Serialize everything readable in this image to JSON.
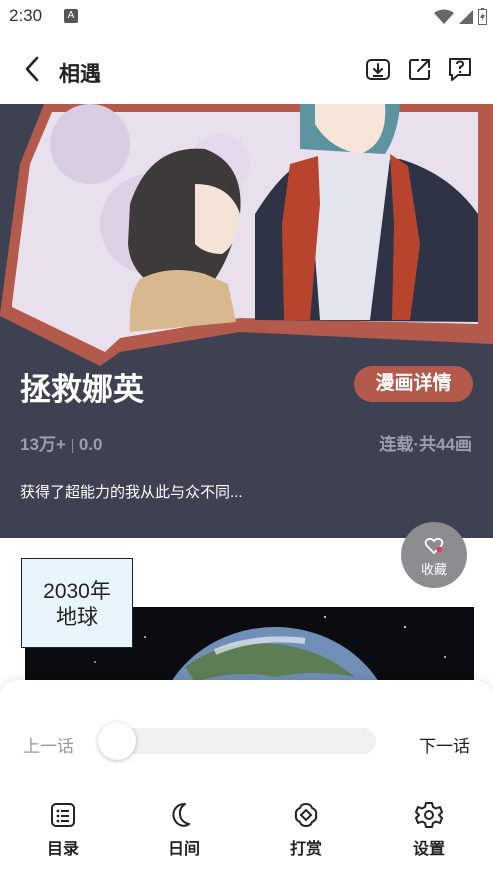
{
  "status_bar": {
    "time": "2:30",
    "notification_glyph": "A"
  },
  "top_bar": {
    "title": "相遇",
    "icons": [
      "back-arrow-icon",
      "download-icon",
      "share-icon",
      "report-icon"
    ]
  },
  "comic": {
    "title": "拯救娜英",
    "detail_button": "漫画详情",
    "popularity": "13万+",
    "rating": "0.0",
    "serial_status": "连载·共44画",
    "description": "获得了超能力的我从此与众不同..."
  },
  "favorite": {
    "label": "收藏"
  },
  "page_content": {
    "caption_line1": "2030年",
    "caption_line2": "地球"
  },
  "reader_controls": {
    "prev_chapter": "上一话",
    "next_chapter": "下一话",
    "progress": 0.0,
    "nav": [
      {
        "label": "目录",
        "icon": "list-icon"
      },
      {
        "label": "日间",
        "icon": "moon-icon"
      },
      {
        "label": "打赏",
        "icon": "reward-icon"
      },
      {
        "label": "设置",
        "icon": "settings-icon"
      }
    ]
  },
  "colors": {
    "header_bg": "#3e4152",
    "accent": "#b35a4c",
    "fav_bg": "#8d8d8f",
    "caption_bg": "#e8f5fc"
  }
}
